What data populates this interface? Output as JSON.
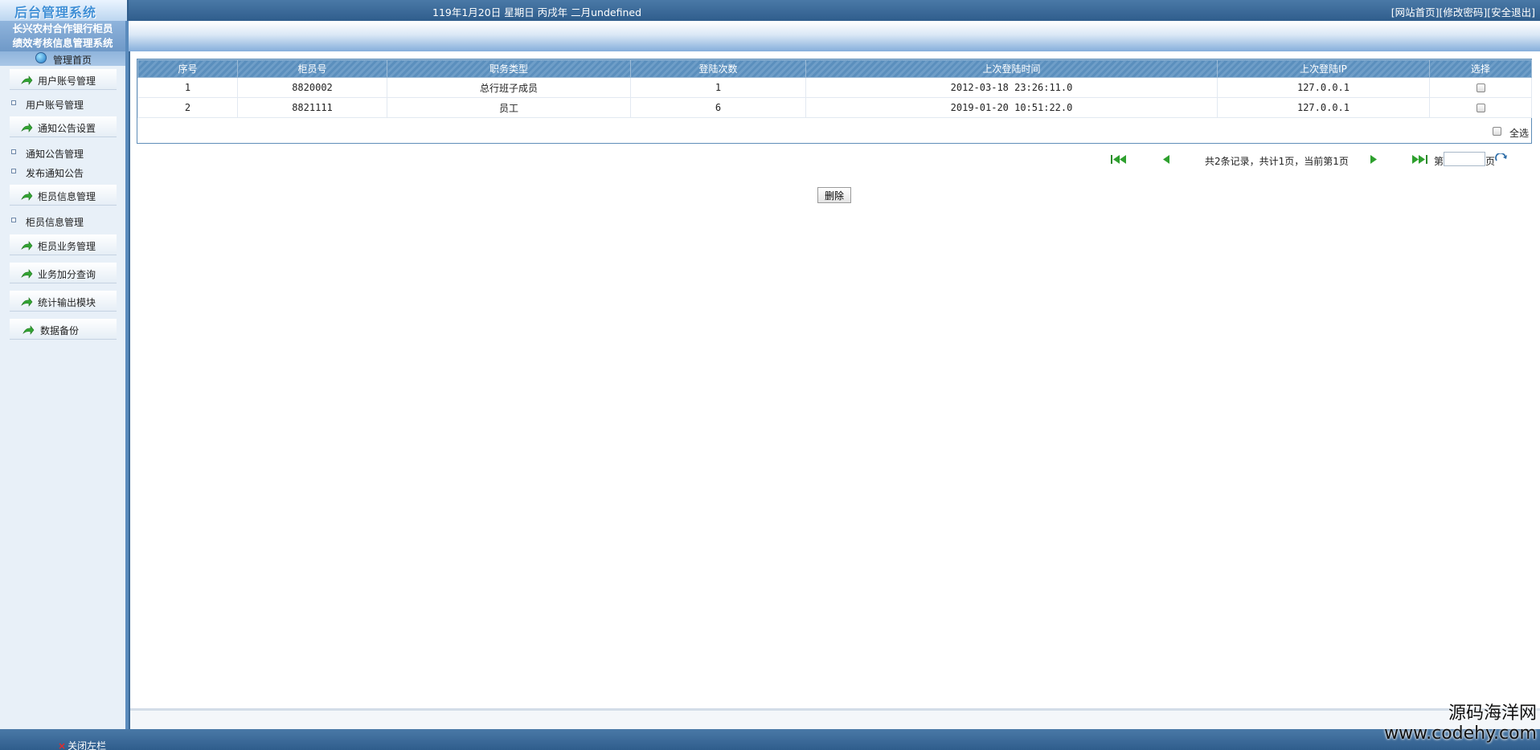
{
  "header": {
    "logo_text": "后台管理系统",
    "date_text": "119年1月20日 星期日 丙戌年 二月undefined",
    "links": [
      "[网站首页]",
      "[修改密码]",
      "[安全退出]"
    ]
  },
  "sidebar": {
    "system_title_line1": "长兴农村合作银行柜员",
    "system_title_line2": "绩效考核信息管理系统",
    "home_label": "管理首页",
    "groups": [
      {
        "label": "用户账号管理",
        "items": [
          "用户账号管理"
        ]
      },
      {
        "label": "通知公告设置",
        "items": [
          "通知公告管理",
          "发布通知公告"
        ]
      },
      {
        "label": "柜员信息管理",
        "items": [
          "柜员信息管理"
        ]
      },
      {
        "label": "柜员业务管理",
        "items": []
      },
      {
        "label": "业务加分查询",
        "items": []
      },
      {
        "label": "统计输出模块",
        "items": []
      },
      {
        "label": "数据备份",
        "items": []
      }
    ]
  },
  "table": {
    "columns": [
      "序号",
      "柜员号",
      "职务类型",
      "登陆次数",
      "上次登陆时间",
      "上次登陆IP",
      "选择"
    ],
    "rows": [
      [
        "1",
        "8820002",
        "总行班子成员",
        "1",
        "2012-03-18 23:26:11.0",
        "127.0.0.1"
      ],
      [
        "2",
        "8821111",
        "员工",
        "6",
        "2019-01-20 10:51:22.0",
        "127.0.0.1"
      ]
    ],
    "select_all_label": "全选"
  },
  "pager": {
    "info": "共2条记录，共计1页，当前第1页",
    "page_prefix": "第",
    "page_suffix": "页",
    "page_value": ""
  },
  "actions": {
    "delete_label": "删除"
  },
  "footer": {
    "close_sidebar_label": "关闭左栏"
  },
  "watermark": {
    "cn": "源码海洋网",
    "url": "www.codehy.com"
  },
  "icons": {
    "menu_arrow": "green-arrow-icon",
    "bullet": "square-bullet-icon",
    "home": "globe-icon",
    "pager_first": "first-page-icon",
    "pager_prev": "prev-page-icon",
    "pager_next": "next-page-icon",
    "pager_last": "last-page-icon",
    "go": "go-refresh-icon"
  },
  "colors": {
    "header_blue": "#3c6a98",
    "grid_header": "#5b8fbd",
    "accent_green": "#2ea02e"
  }
}
